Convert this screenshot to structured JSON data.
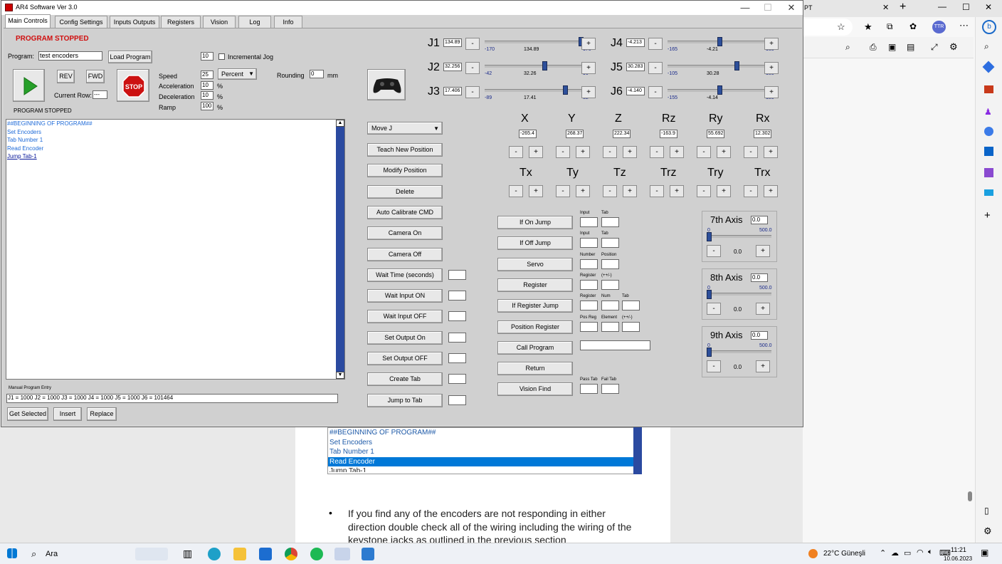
{
  "window": {
    "title": "AR4 Software Ver 3.0",
    "minimize": "—",
    "maximize": "☐",
    "close": "✕"
  },
  "tabs": [
    "Main Controls",
    "Config Settings",
    "Inputs Outputs",
    "Registers",
    "Vision",
    "Log",
    "Info"
  ],
  "status_top": "PROGRAM STOPPED",
  "status_bottom": "PROGRAM STOPPED",
  "program": {
    "label": "Program:",
    "value": "test encoders",
    "load": "Load Program"
  },
  "incjog": {
    "value": "10",
    "label": "Incremental Jog"
  },
  "rev": "REV",
  "fwd": "FWD",
  "stop": "STOP",
  "current_row": {
    "label": "Current Row:",
    "value": "---"
  },
  "speed": {
    "label": "Speed",
    "value": "25",
    "unit": "Percent"
  },
  "accel": {
    "label": "Acceleration",
    "value": "10",
    "unit": "%"
  },
  "decel": {
    "label": "Deceleration",
    "value": "10",
    "unit": "%"
  },
  "ramp": {
    "label": "Ramp",
    "value": "100",
    "unit": "%"
  },
  "rounding": {
    "label": "Rounding",
    "value": "0",
    "unit": "mm"
  },
  "program_lines": [
    "##BEGINNING OF PROGRAM##",
    "Set Encoders",
    "Tab Number 1",
    "Read Encoder",
    "Jump Tab-1"
  ],
  "manual": {
    "label": "Manual Program Entry",
    "value": "J1 = 1000   J2 = 1000   J3 = 1000   J4 = 1000   J5 = 1000   J6 = 101464"
  },
  "bottom_buttons": [
    "Get Selected",
    "Insert",
    "Replace"
  ],
  "move_select": "Move J",
  "cmd_buttons": [
    "Teach New Position",
    "Modify Position",
    "Delete",
    "Auto Calibrate CMD",
    "Camera On",
    "Camera Off",
    "Wait Time (seconds)",
    "Wait Input ON",
    "Wait Input OFF",
    "Set Output On",
    "Set Output OFF",
    "Create Tab",
    "Jump to Tab"
  ],
  "logic_buttons": [
    "If On Jump",
    "If Off Jump",
    "Servo",
    "Register",
    "If Register Jump",
    "Position Register",
    "Call Program",
    "Return",
    "Vision Find"
  ],
  "logic_labels": [
    [
      "Input",
      "Tab"
    ],
    [
      "Input",
      "Tab"
    ],
    [
      "Number",
      "Position"
    ],
    [
      "Register",
      "(++/-)"
    ],
    [
      "Register",
      "Num",
      "Tab"
    ],
    [
      "Pos Reg",
      "Element",
      "(++/-)"
    ],
    [],
    [],
    [
      "Pass Tab",
      "Fail Tab"
    ]
  ],
  "joints": [
    {
      "name": "J1",
      "value": "134.89",
      "min": "-170",
      "cur": "134.89",
      "max": "170",
      "level": 0.897
    },
    {
      "name": "J2",
      "value": "32.256",
      "min": "-42",
      "cur": "32.26",
      "max": "90",
      "level": 0.563
    },
    {
      "name": "J3",
      "value": "17.406",
      "min": "-89",
      "cur": "17.41",
      "max": "52",
      "level": 0.752
    },
    {
      "name": "J4",
      "value": "-4.213",
      "min": "-165",
      "cur": "-4.21",
      "max": "165",
      "level": 0.487
    },
    {
      "name": "J5",
      "value": "30.283",
      "min": "-105",
      "cur": "30.28",
      "max": "105",
      "level": 0.644
    },
    {
      "name": "J6",
      "value": "-4.140",
      "min": "-155",
      "cur": "-4.14",
      "max": "155",
      "level": 0.487
    }
  ],
  "cart": [
    {
      "name": "X",
      "value": "-265.4"
    },
    {
      "name": "Y",
      "value": "268.37"
    },
    {
      "name": "Z",
      "value": "222.34"
    },
    {
      "name": "Rz",
      "value": "-163.9"
    },
    {
      "name": "Ry",
      "value": "55.692"
    },
    {
      "name": "Rx",
      "value": "12.302"
    }
  ],
  "tool": [
    "Tx",
    "Ty",
    "Tz",
    "Trz",
    "Try",
    "Trx"
  ],
  "axes": [
    {
      "name": "7th Axis",
      "value": "0.0",
      "min": "0",
      "max": "500.0",
      "cur": "0.0"
    },
    {
      "name": "8th Axis",
      "value": "0.0",
      "min": "0",
      "max": "500.0",
      "cur": "0.0"
    },
    {
      "name": "9th Axis",
      "value": "0.0",
      "min": "0",
      "max": "500.0",
      "cur": "0.0"
    }
  ],
  "pdf": {
    "list": [
      "##BEGINNING OF PROGRAM##",
      "Set Encoders",
      "Tab Number 1",
      "Read Encoder",
      "Jump Tab-1"
    ],
    "bullet": "•",
    "text": "If you find any of the encoders are not responding in either direction double check all of the wiring including the wiring of the keystone jacks as outlined in the previous section"
  },
  "edge": {
    "tab_text": "PT",
    "avatar": "TTR"
  },
  "taskbar": {
    "search": "Ara",
    "weather": "22°C  Güneşli",
    "time": "11:21",
    "date": "10.06.2023"
  },
  "colors": {
    "accent": "#2b4aa0",
    "stop_red": "#cc1111",
    "status_red": "#d01010",
    "go_green": "#27a02a"
  }
}
